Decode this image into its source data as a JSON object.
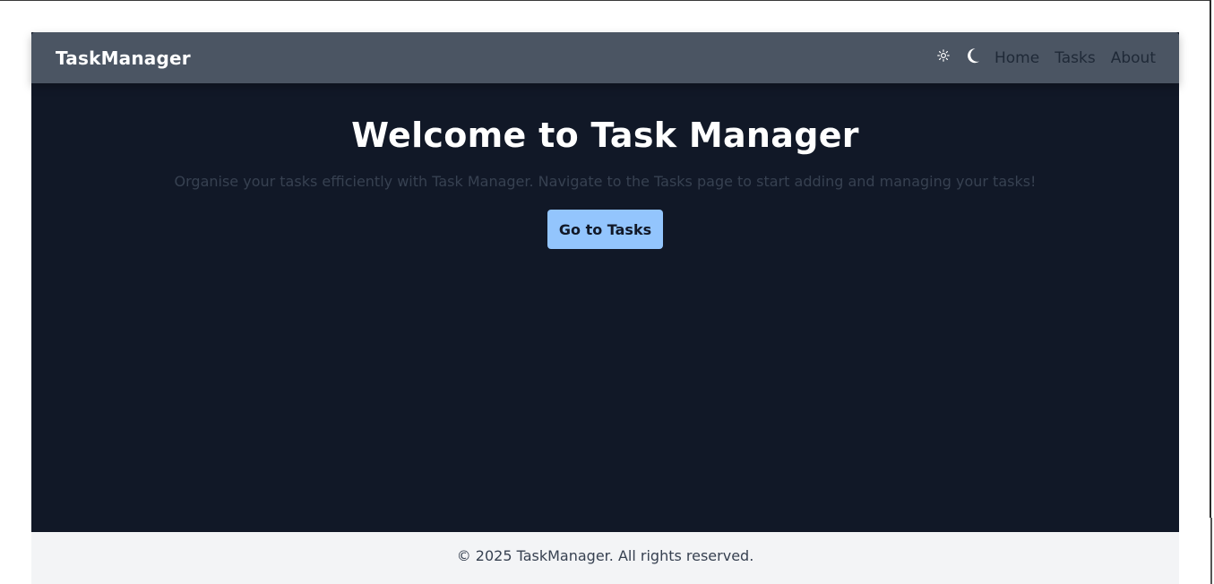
{
  "navbar": {
    "brand": "TaskManager",
    "icons": {
      "light_mode": "sun-icon",
      "dark_mode": "moon-icon"
    },
    "links": [
      "Home",
      "Tasks",
      "About"
    ]
  },
  "hero": {
    "title": "Welcome to Task Manager",
    "subtitle": "Organise your tasks efficiently with Task Manager. Navigate to the Tasks page to start adding and managing your tasks!",
    "cta_label": "Go to Tasks"
  },
  "footer": {
    "text": "© 2025 TaskManager. All rights reserved."
  },
  "colors": {
    "navbar_bg": "#4b5563",
    "page_bg": "#111827",
    "accent_button": "#93c5fd",
    "footer_bg": "#f3f4f6"
  }
}
